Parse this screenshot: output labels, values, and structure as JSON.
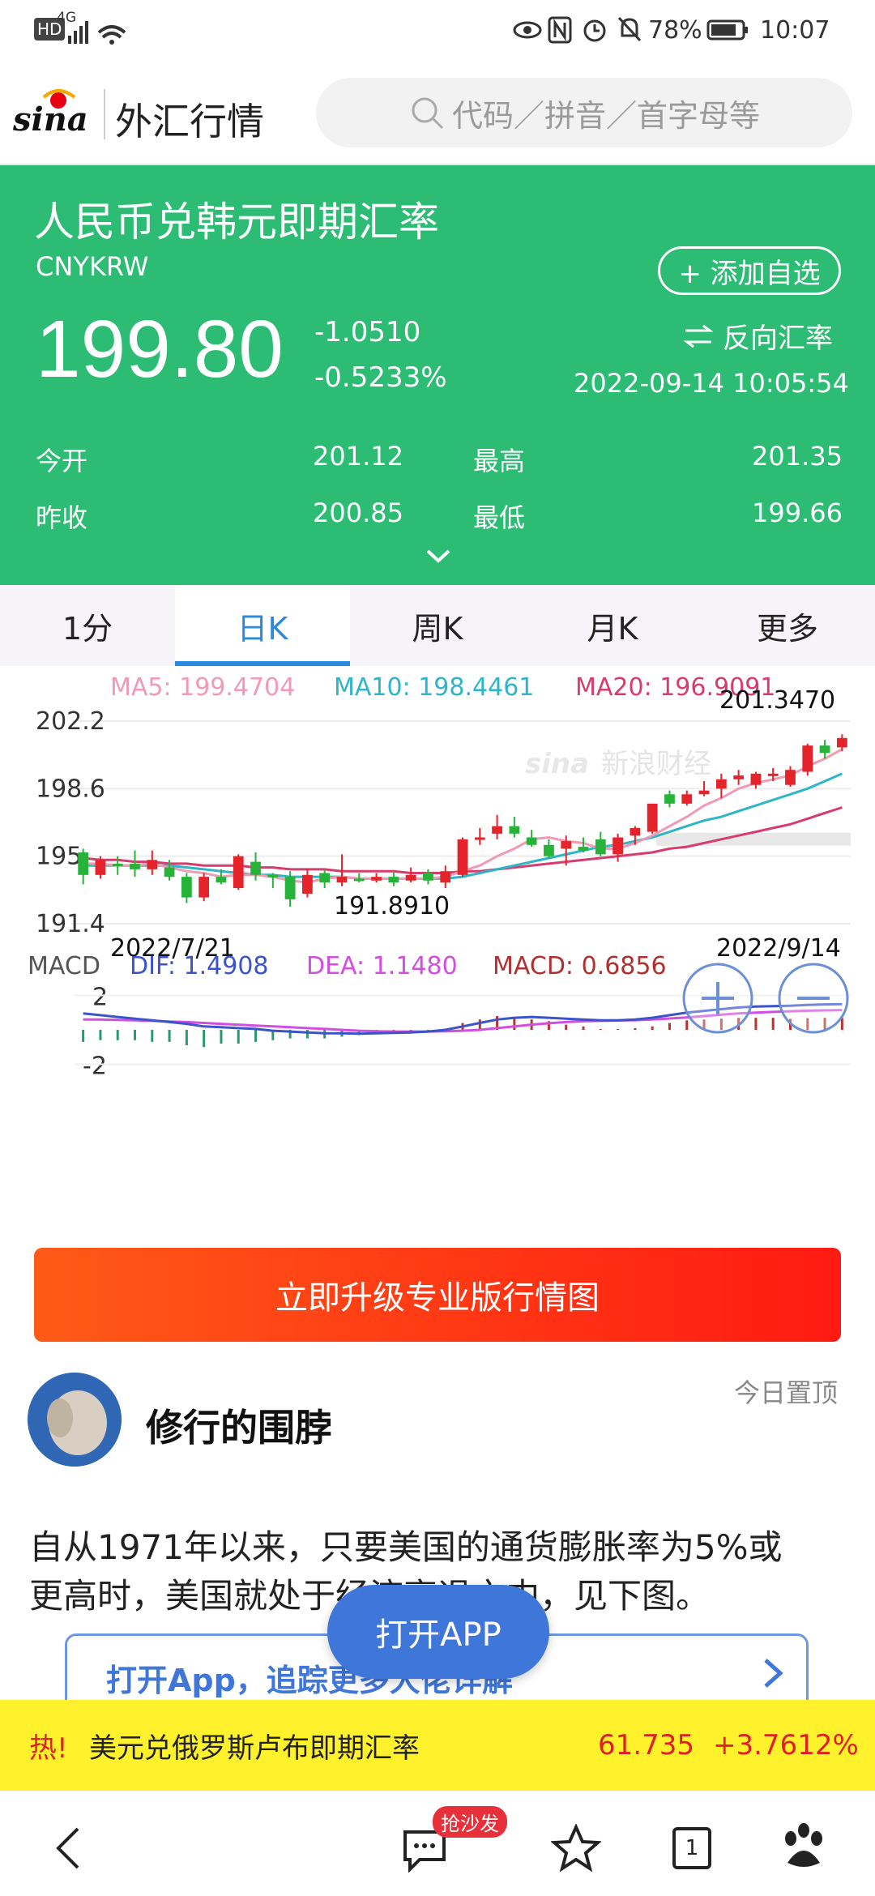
{
  "status_bar": {
    "network": "HD",
    "signal": "4G",
    "battery": "78%",
    "time": "10:07"
  },
  "header": {
    "logo": "sina",
    "title": "外汇行情",
    "search_placeholder": "代码／拼音／首字母等"
  },
  "quote": {
    "name": "人民币兑韩元即期汇率",
    "code": "CNYKRW",
    "add_label": "+ 添加自选",
    "price": "199.80",
    "change": "-1.0510",
    "change_pct": "-0.5233%",
    "reverse_label": "反向汇率",
    "datetime": "2022-09-14 10:05:54",
    "open_label": "今开",
    "open": "201.12",
    "high_label": "最高",
    "high": "201.35",
    "prev_label": "昨收",
    "prev": "200.85",
    "low_label": "最低",
    "low": "199.66",
    "colors": {
      "panel": "#2dbc74"
    }
  },
  "tabs": [
    {
      "label": "1分",
      "active": false
    },
    {
      "label": "日K",
      "active": true
    },
    {
      "label": "周K",
      "active": false
    },
    {
      "label": "月K",
      "active": false
    },
    {
      "label": "更多",
      "active": false
    }
  ],
  "chart_data": {
    "type": "candlestick",
    "ma_labels": {
      "ma5": "MA5: 199.4704",
      "ma10": "MA10: 198.4461",
      "ma20": "MA20: 196.9091"
    },
    "y_ticks": [
      "202.2",
      "198.6",
      "195",
      "191.4"
    ],
    "ylim": [
      191.4,
      202.2
    ],
    "x_start": "2022/7/21",
    "x_end": "2022/9/14",
    "max_label": "201.3470",
    "min_label": "191.8910",
    "watermark": "新浪财经",
    "candles": [
      [
        195.2,
        194.0,
        195.4,
        193.5
      ],
      [
        194.0,
        194.8,
        195.0,
        193.8
      ],
      [
        194.6,
        194.5,
        195.0,
        194.0
      ],
      [
        194.6,
        194.3,
        195.3,
        193.9
      ],
      [
        194.3,
        194.8,
        195.3,
        194.0
      ],
      [
        194.4,
        193.9,
        194.8,
        193.7
      ],
      [
        193.9,
        192.8,
        194.1,
        192.5
      ],
      [
        192.8,
        193.9,
        194.1,
        192.6
      ],
      [
        193.9,
        193.6,
        194.3,
        193.5
      ],
      [
        193.3,
        195.0,
        195.1,
        193.2
      ],
      [
        194.7,
        194.0,
        195.2,
        193.7
      ],
      [
        194.0,
        193.9,
        194.1,
        193.3
      ],
      [
        193.9,
        192.7,
        194.2,
        192.3
      ],
      [
        193.0,
        194.0,
        194.3,
        192.8
      ],
      [
        194.1,
        193.6,
        194.3,
        193.3
      ],
      [
        193.6,
        193.9,
        195.1,
        193.4
      ],
      [
        193.8,
        193.7,
        194.1,
        193.6
      ],
      [
        193.7,
        193.9,
        194.1,
        193.6
      ],
      [
        193.9,
        193.6,
        194.2,
        193.4
      ],
      [
        193.7,
        194.0,
        194.4,
        193.6
      ],
      [
        194.1,
        193.7,
        194.3,
        193.5
      ],
      [
        193.6,
        194.2,
        194.5,
        193.3
      ],
      [
        194.0,
        195.9,
        196.0,
        193.9
      ],
      [
        196.0,
        196.0,
        196.5,
        195.6
      ],
      [
        196.2,
        196.6,
        197.2,
        195.9
      ],
      [
        196.6,
        196.2,
        197.1,
        196.0
      ],
      [
        196.0,
        195.6,
        196.4,
        195.5
      ],
      [
        195.6,
        195.0,
        195.9,
        194.9
      ],
      [
        195.4,
        195.8,
        196.1,
        194.5
      ],
      [
        195.5,
        195.3,
        196.0,
        195.2
      ],
      [
        195.9,
        195.1,
        196.3,
        195.0
      ],
      [
        195.1,
        196.0,
        196.2,
        194.7
      ],
      [
        196.1,
        196.5,
        196.6,
        195.6
      ],
      [
        196.3,
        197.8,
        197.8,
        196.2
      ],
      [
        198.3,
        197.8,
        198.5,
        197.6
      ],
      [
        197.8,
        198.3,
        198.5,
        197.7
      ],
      [
        198.3,
        198.5,
        199.0,
        198.2
      ],
      [
        198.6,
        199.1,
        199.4,
        198.1
      ],
      [
        199.1,
        199.3,
        199.6,
        198.8
      ],
      [
        198.8,
        199.4,
        199.5,
        198.6
      ],
      [
        199.3,
        199.4,
        199.7,
        199.0
      ],
      [
        198.8,
        199.6,
        199.8,
        198.7
      ],
      [
        199.5,
        200.9,
        201.0,
        199.3
      ],
      [
        200.9,
        200.5,
        201.2,
        200.2
      ],
      [
        200.8,
        201.3,
        201.5,
        200.6
      ]
    ],
    "ma5": [
      194.6,
      194.6,
      194.5,
      194.5,
      194.6,
      194.4,
      194.2,
      194.1,
      193.9,
      194.0,
      194.0,
      193.9,
      193.7,
      193.6,
      193.8,
      193.9,
      193.8,
      193.8,
      193.8,
      193.8,
      193.8,
      193.9,
      194.2,
      194.5,
      195.0,
      195.4,
      195.9,
      196.0,
      195.8,
      195.7,
      195.4,
      195.4,
      195.7,
      196.1,
      196.6,
      197.1,
      197.7,
      198.1,
      198.6,
      198.9,
      199.1,
      199.3,
      199.8,
      200.2,
      200.7
    ],
    "ma10": [
      194.5,
      194.5,
      194.5,
      194.5,
      194.5,
      194.5,
      194.4,
      194.3,
      194.2,
      194.1,
      194.0,
      194.0,
      193.9,
      193.9,
      193.9,
      193.9,
      193.8,
      193.8,
      193.8,
      193.8,
      193.8,
      193.8,
      193.9,
      194.1,
      194.3,
      194.5,
      194.7,
      194.9,
      195.1,
      195.3,
      195.5,
      195.6,
      195.8,
      196.0,
      196.3,
      196.6,
      196.9,
      197.1,
      197.4,
      197.7,
      198.0,
      198.3,
      198.6,
      199.0,
      199.4
    ],
    "ma20": [
      194.9,
      194.8,
      194.8,
      194.7,
      194.7,
      194.6,
      194.6,
      194.5,
      194.5,
      194.5,
      194.4,
      194.4,
      194.3,
      194.3,
      194.3,
      194.2,
      194.2,
      194.2,
      194.2,
      194.1,
      194.1,
      194.1,
      194.2,
      194.2,
      194.3,
      194.4,
      194.5,
      194.6,
      194.7,
      194.8,
      194.9,
      195.0,
      195.1,
      195.2,
      195.4,
      195.5,
      195.7,
      195.9,
      196.1,
      196.3,
      196.5,
      196.7,
      197.0,
      197.3,
      197.6
    ]
  },
  "macd": {
    "label": "MACD",
    "dif_label": "DIF: 1.4908",
    "dea_label": "DEA: 1.1480",
    "macd_label": "MACD: 0.6856",
    "y_ticks": [
      "2",
      "-2"
    ],
    "ylim": [
      -2.4,
      2.4
    ],
    "dif": [
      0.95,
      0.85,
      0.75,
      0.65,
      0.55,
      0.45,
      0.35,
      0.2,
      0.15,
      0.1,
      0.05,
      -0.05,
      -0.1,
      -0.15,
      -0.2,
      -0.2,
      -0.22,
      -0.2,
      -0.18,
      -0.15,
      -0.1,
      0.0,
      0.2,
      0.4,
      0.6,
      0.7,
      0.75,
      0.7,
      0.65,
      0.6,
      0.55,
      0.55,
      0.6,
      0.7,
      0.85,
      1.0,
      1.1,
      1.2,
      1.3,
      1.35,
      1.38,
      1.4,
      1.45,
      1.48,
      1.49
    ],
    "dea": [
      0.6,
      0.6,
      0.58,
      0.55,
      0.52,
      0.48,
      0.45,
      0.4,
      0.35,
      0.3,
      0.25,
      0.2,
      0.15,
      0.1,
      0.05,
      0.0,
      -0.05,
      -0.08,
      -0.1,
      -0.1,
      -0.1,
      -0.08,
      -0.05,
      0.0,
      0.1,
      0.2,
      0.3,
      0.38,
      0.45,
      0.5,
      0.52,
      0.54,
      0.56,
      0.6,
      0.66,
      0.72,
      0.8,
      0.88,
      0.95,
      1.0,
      1.04,
      1.08,
      1.11,
      1.13,
      1.15
    ],
    "hist": [
      -0.7,
      -0.6,
      -0.6,
      -0.6,
      -0.7,
      -0.7,
      -0.9,
      -1.0,
      -0.8,
      -0.8,
      -0.7,
      -0.6,
      -0.5,
      -0.5,
      -0.5,
      -0.4,
      -0.3,
      -0.25,
      -0.2,
      -0.15,
      -0.1,
      -0.05,
      0.4,
      0.6,
      0.8,
      0.7,
      0.6,
      0.5,
      0.3,
      0.2,
      0.05,
      0.05,
      0.1,
      0.2,
      0.4,
      0.55,
      0.6,
      0.65,
      0.7,
      0.7,
      0.7,
      0.64,
      0.68,
      0.7,
      0.69
    ]
  },
  "upgrade_button": "立即升级专业版行情图",
  "post": {
    "author": "修行的围脖",
    "pinned": "今日置顶",
    "text_line1": "自从1971年以来，只要美国的通货膨胀率为5%或",
    "text_line2": "更高时，美国就处于经济衰退之中，见下图。",
    "link_text": "打开App，追踪更多大佬详解"
  },
  "open_app": "打开APP",
  "hot": {
    "tag": "热!",
    "name": "美元兑俄罗斯卢布即期汇率",
    "price": "61.735",
    "change": "+3.7612%"
  },
  "nav": {
    "badge": "抢沙发",
    "tabs_count": "1"
  }
}
